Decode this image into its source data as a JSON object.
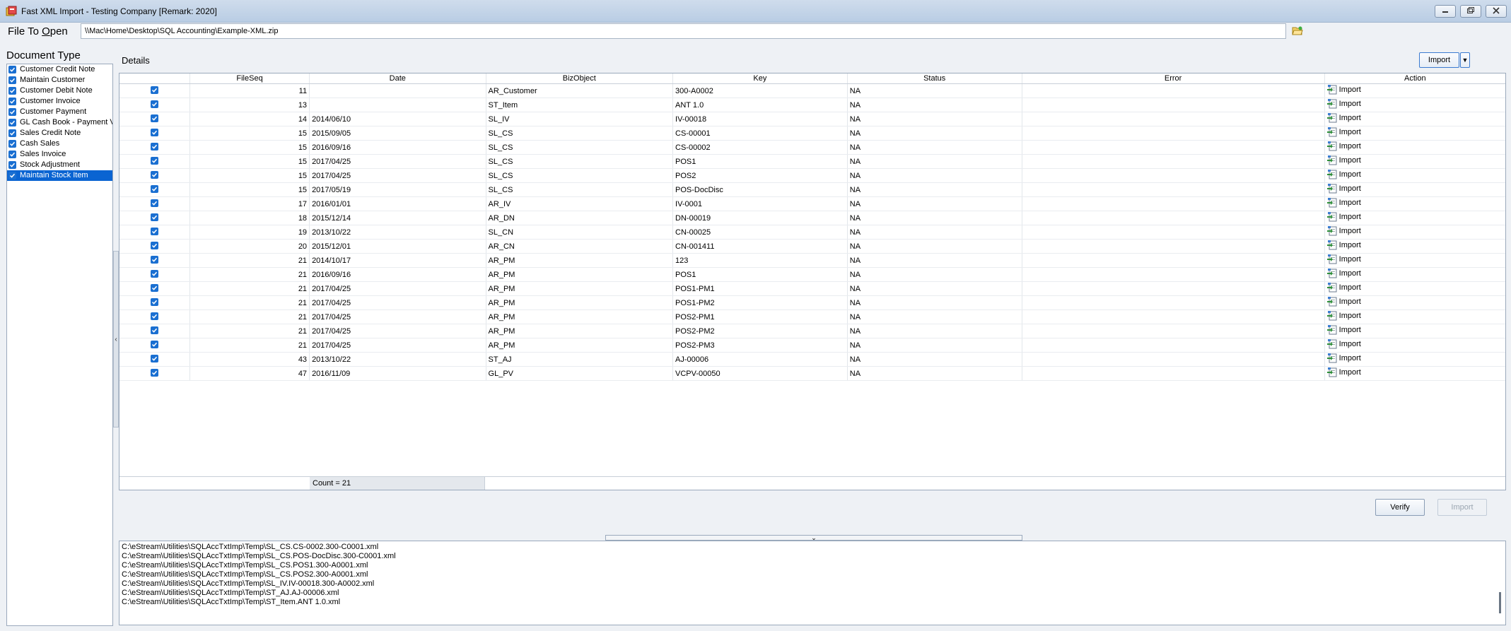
{
  "window": {
    "title": "Fast XML Import - Testing Company [Remark: 2020]",
    "minimize_icon": "minimize-icon",
    "maximize_icon": "maximize-icon",
    "close_icon": "close-icon"
  },
  "file_row": {
    "label_prefix": "File To ",
    "label_underlined": "O",
    "label_suffix": "pen",
    "path": "\\\\Mac\\Home\\Desktop\\SQL Accounting\\Example-XML.zip",
    "browse_icon": "folder-open-icon"
  },
  "doc_type": {
    "label": "Document Type",
    "items": [
      {
        "label": "Customer Credit Note",
        "checked": true,
        "selected": false
      },
      {
        "label": "Maintain Customer",
        "checked": true,
        "selected": false
      },
      {
        "label": "Customer Debit Note",
        "checked": true,
        "selected": false
      },
      {
        "label": "Customer Invoice",
        "checked": true,
        "selected": false
      },
      {
        "label": "Customer Payment",
        "checked": true,
        "selected": false
      },
      {
        "label": "GL Cash Book - Payment V",
        "checked": true,
        "selected": false
      },
      {
        "label": "Sales Credit Note",
        "checked": true,
        "selected": false
      },
      {
        "label": "Cash Sales",
        "checked": true,
        "selected": false
      },
      {
        "label": "Sales Invoice",
        "checked": true,
        "selected": false
      },
      {
        "label": "Stock Adjustment",
        "checked": true,
        "selected": false
      },
      {
        "label": "Maintain Stock Item",
        "checked": true,
        "selected": true
      }
    ]
  },
  "details": {
    "title": "Details",
    "import_label": "Import",
    "columns": [
      "",
      "FileSeq",
      "Date",
      "BizObject",
      "Key",
      "Status",
      "Error",
      "Action"
    ],
    "rows": [
      {
        "seq": "11",
        "date": "",
        "biz": "AR_Customer",
        "key": "300-A0002",
        "status": "NA",
        "error": "",
        "action": "Import"
      },
      {
        "seq": "13",
        "date": "",
        "biz": "ST_Item",
        "key": "ANT 1.0",
        "status": "NA",
        "error": "",
        "action": "Import"
      },
      {
        "seq": "14",
        "date": "2014/06/10",
        "biz": "SL_IV",
        "key": "IV-00018",
        "status": "NA",
        "error": "",
        "action": "Import"
      },
      {
        "seq": "15",
        "date": "2015/09/05",
        "biz": "SL_CS",
        "key": "CS-00001",
        "status": "NA",
        "error": "",
        "action": "Import"
      },
      {
        "seq": "15",
        "date": "2016/09/16",
        "biz": "SL_CS",
        "key": "CS-00002",
        "status": "NA",
        "error": "",
        "action": "Import"
      },
      {
        "seq": "15",
        "date": "2017/04/25",
        "biz": "SL_CS",
        "key": "POS1",
        "status": "NA",
        "error": "",
        "action": "Import"
      },
      {
        "seq": "15",
        "date": "2017/04/25",
        "biz": "SL_CS",
        "key": "POS2",
        "status": "NA",
        "error": "",
        "action": "Import"
      },
      {
        "seq": "15",
        "date": "2017/05/19",
        "biz": "SL_CS",
        "key": "POS-DocDisc",
        "status": "NA",
        "error": "",
        "action": "Import"
      },
      {
        "seq": "17",
        "date": "2016/01/01",
        "biz": "AR_IV",
        "key": "IV-0001",
        "status": "NA",
        "error": "",
        "action": "Import"
      },
      {
        "seq": "18",
        "date": "2015/12/14",
        "biz": "AR_DN",
        "key": "DN-00019",
        "status": "NA",
        "error": "",
        "action": "Import"
      },
      {
        "seq": "19",
        "date": "2013/10/22",
        "biz": "SL_CN",
        "key": "CN-00025",
        "status": "NA",
        "error": "",
        "action": "Import"
      },
      {
        "seq": "20",
        "date": "2015/12/01",
        "biz": "AR_CN",
        "key": "CN-001411",
        "status": "NA",
        "error": "",
        "action": "Import"
      },
      {
        "seq": "21",
        "date": "2014/10/17",
        "biz": "AR_PM",
        "key": "123",
        "status": "NA",
        "error": "",
        "action": "Import"
      },
      {
        "seq": "21",
        "date": "2016/09/16",
        "biz": "AR_PM",
        "key": "POS1",
        "status": "NA",
        "error": "",
        "action": "Import"
      },
      {
        "seq": "21",
        "date": "2017/04/25",
        "biz": "AR_PM",
        "key": "POS1-PM1",
        "status": "NA",
        "error": "",
        "action": "Import"
      },
      {
        "seq": "21",
        "date": "2017/04/25",
        "biz": "AR_PM",
        "key": "POS1-PM2",
        "status": "NA",
        "error": "",
        "action": "Import"
      },
      {
        "seq": "21",
        "date": "2017/04/25",
        "biz": "AR_PM",
        "key": "POS2-PM1",
        "status": "NA",
        "error": "",
        "action": "Import"
      },
      {
        "seq": "21",
        "date": "2017/04/25",
        "biz": "AR_PM",
        "key": "POS2-PM2",
        "status": "NA",
        "error": "",
        "action": "Import"
      },
      {
        "seq": "21",
        "date": "2017/04/25",
        "biz": "AR_PM",
        "key": "POS2-PM3",
        "status": "NA",
        "error": "",
        "action": "Import"
      },
      {
        "seq": "43",
        "date": "2013/10/22",
        "biz": "ST_AJ",
        "key": "AJ-00006",
        "status": "NA",
        "error": "",
        "action": "Import"
      },
      {
        "seq": "47",
        "date": "2016/11/09",
        "biz": "GL_PV",
        "key": "VCPV-00050",
        "status": "NA",
        "error": "",
        "action": "Import"
      }
    ],
    "count_text": "Count = 21"
  },
  "buttons": {
    "verify": "Verify",
    "import": "Import"
  },
  "log": {
    "lines": [
      "C:\\eStream\\Utilities\\SQLAccTxtImp\\Temp\\SL_CS.CS-0002.300-C0001.xml",
      "C:\\eStream\\Utilities\\SQLAccTxtImp\\Temp\\SL_CS.POS-DocDisc.300-C0001.xml",
      "C:\\eStream\\Utilities\\SQLAccTxtImp\\Temp\\SL_CS.POS1.300-A0001.xml",
      "C:\\eStream\\Utilities\\SQLAccTxtImp\\Temp\\SL_CS.POS2.300-A0001.xml",
      "C:\\eStream\\Utilities\\SQLAccTxtImp\\Temp\\SL_IV.IV-00018.300-A0002.xml",
      "C:\\eStream\\Utilities\\SQLAccTxtImp\\Temp\\ST_AJ.AJ-00006.xml",
      "C:\\eStream\\Utilities\\SQLAccTxtImp\\Temp\\ST_Item.ANT 1.0.xml"
    ]
  },
  "colors": {
    "accent": "#0a64d2",
    "checkbox": "#1a6fd1",
    "titlebar": "#c4d5ea"
  }
}
